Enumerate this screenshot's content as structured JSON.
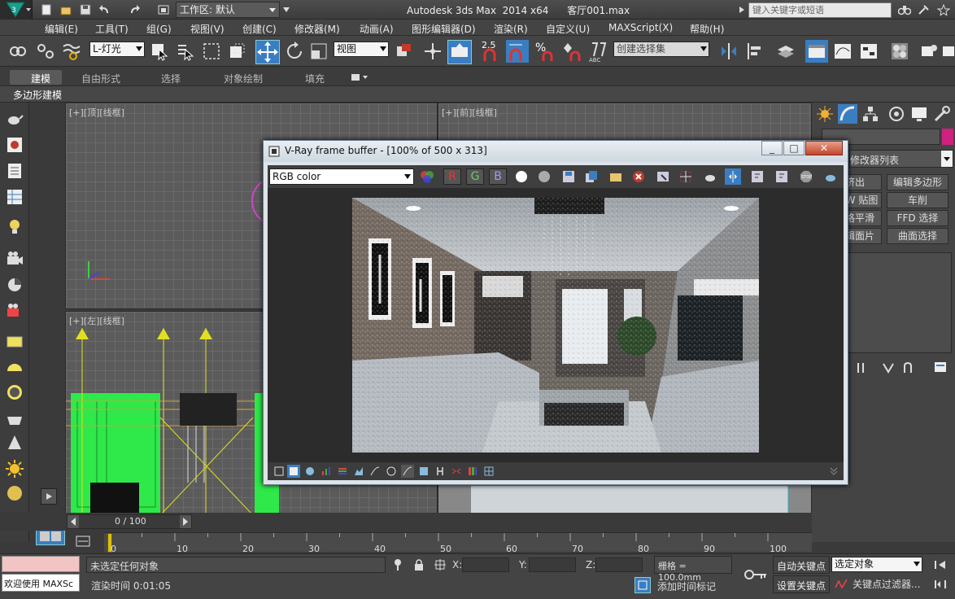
{
  "titlebar": {
    "workspace_label": "工作区: 默认",
    "title": "Autodesk 3ds Max  2014 x64      客厅001.max",
    "search_placeholder": "键入关键字或短语"
  },
  "menubar": [
    "编辑(E)",
    "工具(T)",
    "组(G)",
    "视图(V)",
    "创建(C)",
    "修改器(M)",
    "动画(A)",
    "图形编辑器(D)",
    "渲染(R)",
    "自定义(U)",
    "MAXScript(X)",
    "帮助(H)"
  ],
  "toolbar": {
    "filter_dropdown": "L-灯光",
    "coord_dropdown": "视图",
    "selection_set": "创建选择集",
    "snap_value": "2.5"
  },
  "ribbon": {
    "tabs": [
      "建模",
      "自由形式",
      "选择",
      "对象绘制",
      "填充"
    ],
    "sub_label": "多边形建模"
  },
  "viewports": {
    "top": "[+][顶][线框]",
    "front": "[+][前][线框]",
    "left": "[+][左][线框]"
  },
  "command_panel": {
    "modifier_list": "修改器列表",
    "buttons": [
      [
        "挤出",
        "编辑多边形"
      ],
      [
        "UVW 贴图",
        "车削"
      ],
      [
        "网格平滑",
        "FFD 选择"
      ],
      [
        "编辑面片",
        "曲面选择"
      ]
    ]
  },
  "vfb": {
    "title": "V-Ray frame buffer - [100% of 500 x 313]",
    "channel": "RGB color",
    "r": "R",
    "g": "G",
    "b": "B",
    "window_buttons": [
      "_",
      "□",
      "✕"
    ]
  },
  "timeline": {
    "frame_counter": "0 / 100",
    "ticks": [
      "0",
      "10",
      "20",
      "30",
      "40",
      "50",
      "60",
      "70",
      "80",
      "90",
      "100"
    ]
  },
  "status": {
    "welcome": "欢迎使用  MAXSc",
    "selection_msg": "未选定任何对象",
    "render_time": "渲染时间  0:01:05",
    "x_label": "X:",
    "y_label": "Y:",
    "z_label": "Z:",
    "grid": "栅格 = 100.0mm",
    "auto_key": "自动关键点",
    "set_key": "设置关键点",
    "selected_dropdown": "选定对象",
    "key_filter": "关键点过滤器...",
    "add_time_tag": "添加时间标记"
  },
  "colors": {
    "accent_blue": "#3a7ec2",
    "vfb_red": "#c0392b",
    "status_pink": "#f3c4c4"
  }
}
